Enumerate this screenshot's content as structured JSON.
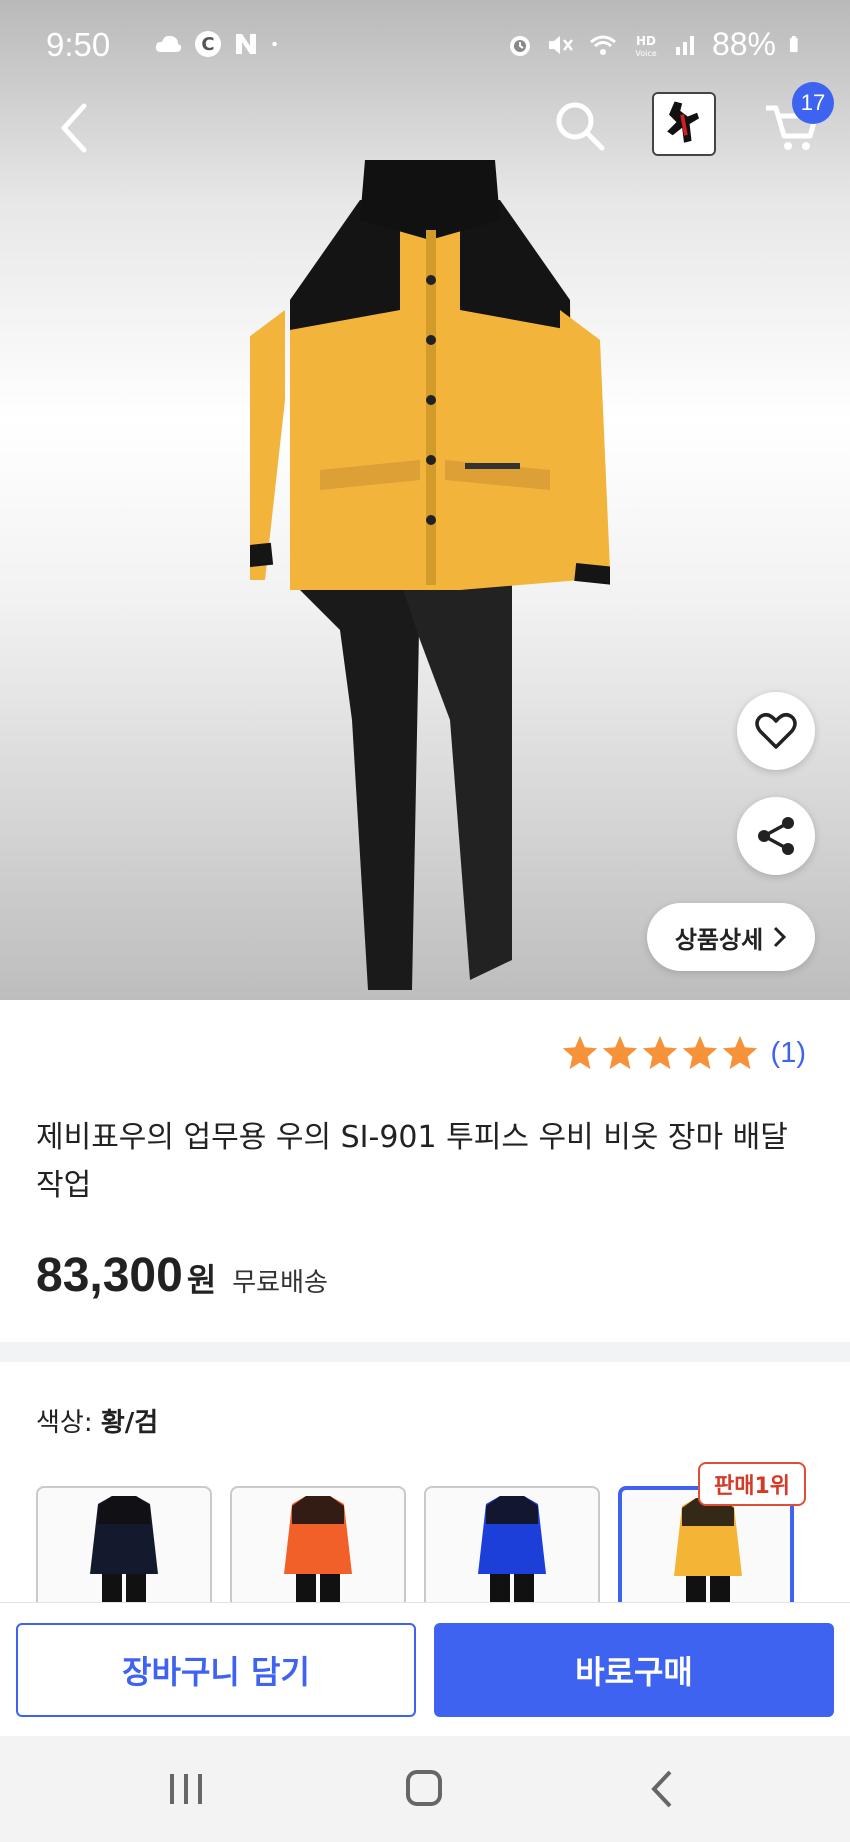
{
  "status_bar": {
    "time": "9:50",
    "battery": "88%",
    "left_icons": [
      "cloud-icon",
      "c-badge-icon",
      "n-logo-icon",
      "dot-icon"
    ],
    "right_icons": [
      "alarm-icon",
      "mute-icon",
      "wifi-icon",
      "hd-voice-icon",
      "signal-icon",
      "battery-icon"
    ]
  },
  "nav": {
    "cart_count": "17"
  },
  "product": {
    "rating_stars": 5,
    "review_count": "(1)",
    "title": "제비표우의 업무용 우의 SI-901 투피스 우비 비옷 장마 배달 작업",
    "price": "83,300",
    "price_unit": "원",
    "shipping": "무료배송",
    "detail_button": "상품상세"
  },
  "options": {
    "color_label": "색상:",
    "color_value": "황/검",
    "best_badge": "판매1위",
    "swatches": [
      {
        "color_name": "navy",
        "top": "#141a2e",
        "bottom": "#111"
      },
      {
        "color_name": "orange",
        "top": "#f2602a",
        "bottom": "#111"
      },
      {
        "color_name": "blue",
        "top": "#1d3fd9",
        "bottom": "#111"
      },
      {
        "color_name": "yellow",
        "top": "#f4b536",
        "bottom": "#111",
        "selected": true
      }
    ]
  },
  "actions": {
    "add_to_cart": "장바구니 담기",
    "buy_now": "바로구매"
  },
  "colors": {
    "accent": "#3d63f0",
    "badge_red": "#d63a26",
    "star": "#f5923a"
  }
}
